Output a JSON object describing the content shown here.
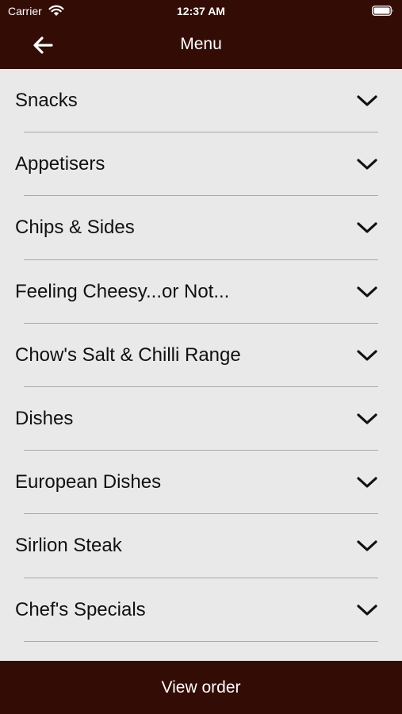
{
  "status_bar": {
    "carrier": "Carrier",
    "time": "12:37 AM"
  },
  "header": {
    "title": "Menu",
    "back_icon": "arrow-left-icon"
  },
  "menu": {
    "items": [
      {
        "label": "Snacks"
      },
      {
        "label": "Appetisers"
      },
      {
        "label": "Chips & Sides"
      },
      {
        "label": "Feeling Cheesy...or Not..."
      },
      {
        "label": "Chow's Salt & Chilli Range"
      },
      {
        "label": "Dishes"
      },
      {
        "label": "European Dishes"
      },
      {
        "label": "Sirlion Steak"
      },
      {
        "label": "Chef's Specials"
      }
    ],
    "expand_icon": "chevron-down-icon"
  },
  "footer": {
    "label": "View order"
  },
  "colors": {
    "bar_background": "#330c06",
    "page_background": "#e9e9e9",
    "text": "#111111",
    "divider": "#a9a9a9"
  }
}
